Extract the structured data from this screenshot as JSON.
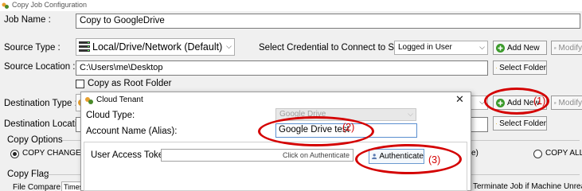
{
  "window": {
    "title": "Copy Job Configuration"
  },
  "main": {
    "job_name_label": "Job Name :",
    "job_name_value": "Copy to GoogleDrive",
    "source_type_label": "Source Type :",
    "source_type_value": "Local/Drive/Network (Default)",
    "credential_label": "Select Credential to Connect to Source:",
    "credential_value": "Logged in User",
    "add_new_label": "Add New",
    "modify_label": "Modify",
    "source_location_label": "Source Location :",
    "source_location_value": "C:\\Users\\me\\Desktop",
    "select_folder_label": "Select Folder",
    "copy_root_label": "Copy as Root Folder",
    "destination_type_label": "Destination Type :",
    "destination_location_label": "Destination Location :",
    "copy_options_label": "Copy Options",
    "copy_changes_label": "COPY CHANGES ON",
    "copy_all_label": "COPY ALL",
    "partial_paren": "e)",
    "copy_flag_label": "Copy Flag",
    "file_compare_label": "File Compare :",
    "file_compare_value": "Timest",
    "terminate_label": "Terminate Job if Machine Unreachal"
  },
  "dialog": {
    "title": "Cloud Tenant",
    "close_glyph": "✕",
    "cloud_type_label": "Cloud Type:",
    "cloud_type_value": "Google Drive",
    "account_name_label": "Account Name (Alias):",
    "account_name_value": "Google Drive test",
    "user_token_label": "User Access Token:",
    "user_token_placeholder": "Click on Authenticate",
    "authenticate_label": "Authenticate"
  },
  "annotations": {
    "step1": "(1)",
    "step2": "(2)",
    "step3": "(3)",
    "color": "#d40000"
  },
  "icons": {
    "window": "copy-job-icon",
    "source_type": "drive-icon",
    "add": "plus-icon",
    "modify": "edit-icon",
    "folder": "folder-icon",
    "user": "user-icon"
  }
}
